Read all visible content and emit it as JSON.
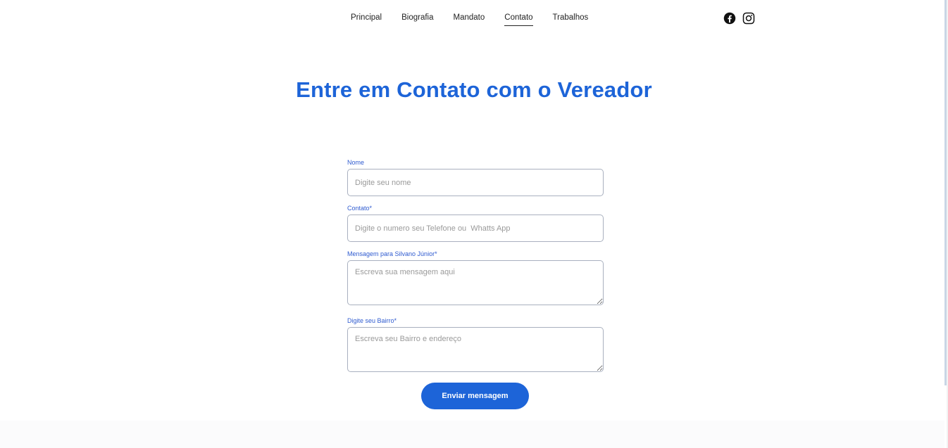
{
  "nav": {
    "items": [
      {
        "label": "Principal",
        "active": false
      },
      {
        "label": "Biografia",
        "active": false
      },
      {
        "label": "Mandato",
        "active": false
      },
      {
        "label": "Contato",
        "active": true
      },
      {
        "label": "Trabalhos",
        "active": false
      }
    ]
  },
  "social": {
    "icons": [
      "facebook-icon",
      "instagram-icon"
    ]
  },
  "page": {
    "title": "Entre em Contato com o Vereador"
  },
  "form": {
    "name": {
      "label": "Nome",
      "placeholder": "Digite seu nome",
      "value": ""
    },
    "contact": {
      "label": "Contato*",
      "placeholder": "Digite o numero seu Telefone ou  Whatts App",
      "value": ""
    },
    "message": {
      "label": "Mensagem para Silvano Júnior*",
      "placeholder": "Escreva sua mensagem aqui",
      "value": ""
    },
    "district": {
      "label": "Digite seu Bairro*",
      "placeholder": "Escreva seu Bairro e endereço",
      "value": ""
    },
    "submit_label": "Enviar mensagem"
  },
  "colors": {
    "accent": "#1d64d8",
    "label": "#2f5bd0",
    "border": "#a9b0bf"
  }
}
